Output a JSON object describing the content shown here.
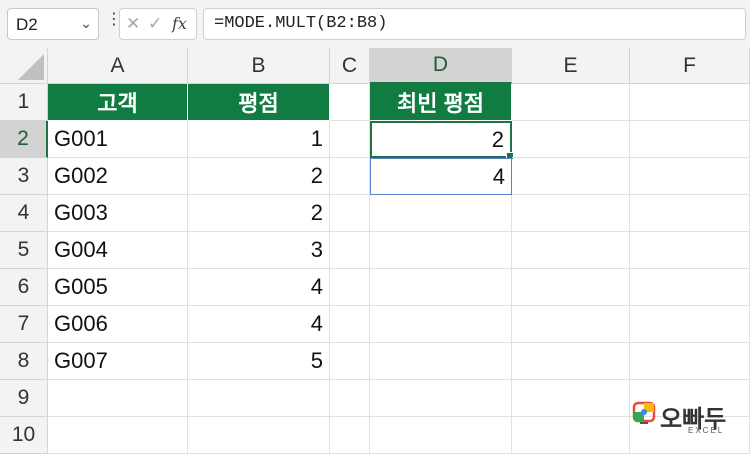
{
  "name_box": {
    "value": "D2"
  },
  "formula_bar": {
    "formula": "=MODE.MULT(B2:B8)",
    "cancel_glyph": "✕",
    "enter_glyph": "✓",
    "fx_glyph": "fx"
  },
  "columns": [
    "A",
    "B",
    "C",
    "D",
    "E",
    "F"
  ],
  "rows": [
    "1",
    "2",
    "3",
    "4",
    "5",
    "6",
    "7",
    "8",
    "9",
    "10"
  ],
  "table": {
    "headers": [
      "고객",
      "평점"
    ],
    "rows": [
      [
        "G001",
        "1"
      ],
      [
        "G002",
        "2"
      ],
      [
        "G003",
        "2"
      ],
      [
        "G004",
        "3"
      ],
      [
        "G005",
        "4"
      ],
      [
        "G006",
        "4"
      ],
      [
        "G007",
        "5"
      ]
    ]
  },
  "result": {
    "header": "최빈 평점",
    "values": [
      "2",
      "4"
    ]
  },
  "logo": {
    "name": "오빠두",
    "sub": "EXCEL"
  },
  "colors": {
    "header_green": "#107c41",
    "selection_green": "#217346",
    "spill_blue": "#5b82c9"
  }
}
